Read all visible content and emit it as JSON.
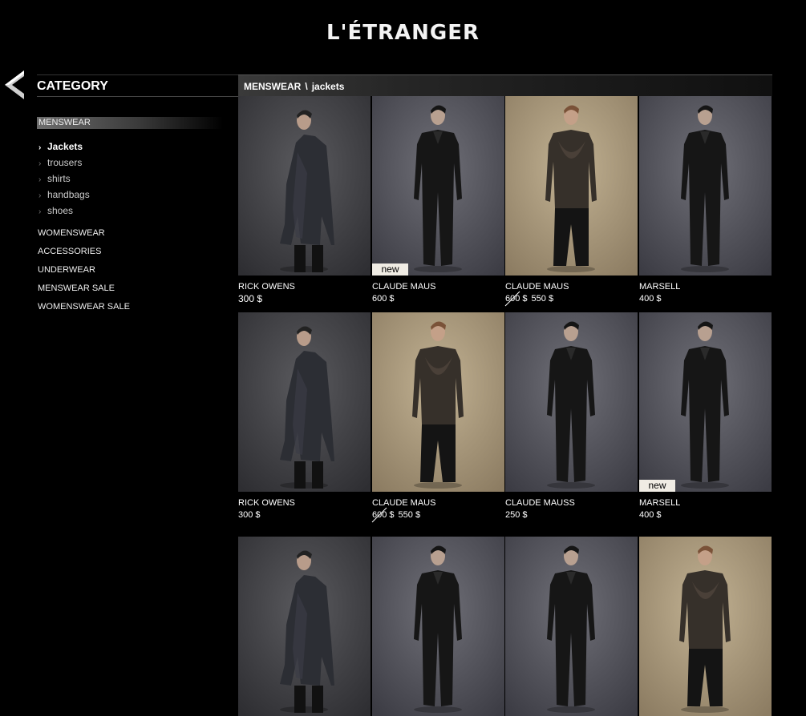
{
  "site": {
    "logo": "L'ÉTRANGER"
  },
  "sidebar": {
    "heading": "CATEGORY",
    "active_category": "MENSWEAR",
    "subcategories": [
      {
        "label": "Jackets",
        "active": true
      },
      {
        "label": "trousers"
      },
      {
        "label": "shirts"
      },
      {
        "label": "handbags"
      },
      {
        "label": "shoes"
      }
    ],
    "categories": [
      "WOMENSWEAR",
      "ACCESSORIES",
      "UNDERWEAR",
      "MENSWEAR SALE",
      "WOMENSWEAR SALE"
    ]
  },
  "breadcrumb": {
    "section": "MENSWEAR",
    "separator": "\\",
    "page": "jackets"
  },
  "badge_label": "new",
  "colors": {
    "background": "#000000",
    "text": "#ffffff",
    "badge_bg": "#f0ece4"
  },
  "products": [
    {
      "brand": "RICK OWENS",
      "price": "300 $",
      "photo": "coat"
    },
    {
      "brand": "CLAUDE MAUS",
      "price": "600 $",
      "photo": "jumpsuit",
      "is_new": true
    },
    {
      "brand": "CLAUDE MAUS",
      "old_price": "600 $",
      "price": "550 $",
      "photo": "drape"
    },
    {
      "brand": "MARSELL",
      "price": "400 $",
      "photo": "jumpsuit"
    },
    {
      "brand": "RICK OWENS",
      "price": "300 $",
      "photo": "coat"
    },
    {
      "brand": "CLAUDE MAUS",
      "old_price": "600 $",
      "price": "550 $",
      "photo": "drape"
    },
    {
      "brand": "CLAUDE MAUSS",
      "price": "250 $",
      "photo": "jumpsuit"
    },
    {
      "brand": "MARSELL",
      "price": "400 $",
      "photo": "jumpsuit",
      "is_new": true
    },
    {
      "photo": "coat"
    },
    {
      "photo": "jumpsuit"
    },
    {
      "photo": "jumpsuit"
    },
    {
      "photo": "drape"
    }
  ]
}
